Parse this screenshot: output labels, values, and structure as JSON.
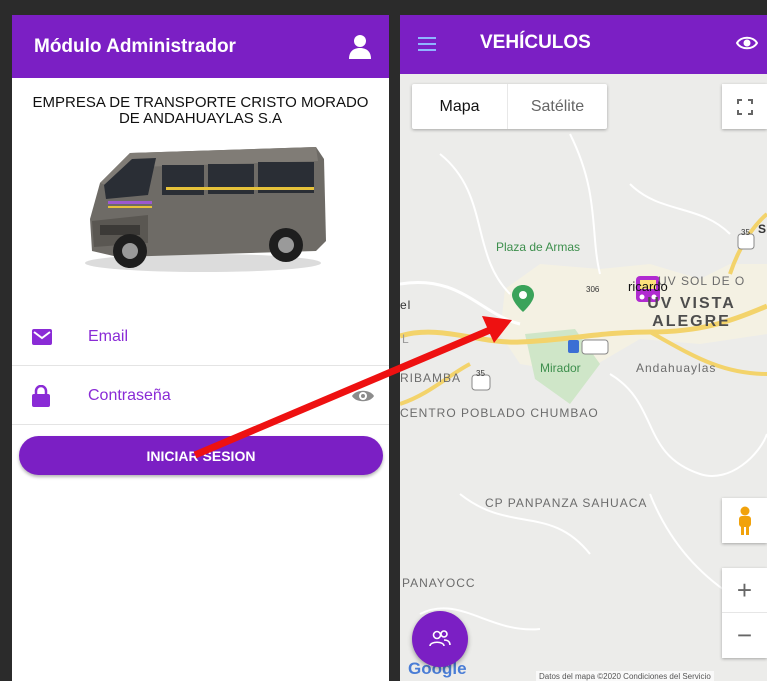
{
  "left_screen": {
    "header_title": "Módulo Administrador",
    "company_name": "EMPRESA DE TRANSPORTE CRISTO MORADO\nDE ANDAHUAYLAS S.A",
    "email_label": "Email",
    "password_label": "Contraseña",
    "login_button": "INICIAR SESION"
  },
  "right_screen": {
    "header_title": "VEHÍCULOS",
    "map_type_map": "Mapa",
    "map_type_satellite": "Satélite",
    "zoom_in": "+",
    "zoom_out": "−",
    "google_logo": "Google",
    "map_attribution": "Datos del mapa ©2020   Condiciones del Servicio",
    "vehicle_marker_label": "ricardo",
    "places": {
      "plaza": "Plaza de\nArmas",
      "uv_sol": "UV SOL DE O",
      "uv_vista": "UV VISTA\nALEGRE",
      "mirador": "Mirador",
      "andahuaylas": "Andahuaylas",
      "bamba": "RIBAMBA",
      "centro": "CENTRO\nPOBLADO\nCHUMBAO",
      "panpanza": "CP PANPANZA\nSAHUACA",
      "panayocc": "PANAYOCC",
      "el": "el",
      "l": "L",
      "route_35": "35",
      "route_306": "306",
      "route_35b": "35",
      "s_letter": "S"
    }
  },
  "colors": {
    "header_purple": "#7b1fc4",
    "label_purple": "#8a2bd6",
    "arrow_red": "#ee1111"
  }
}
